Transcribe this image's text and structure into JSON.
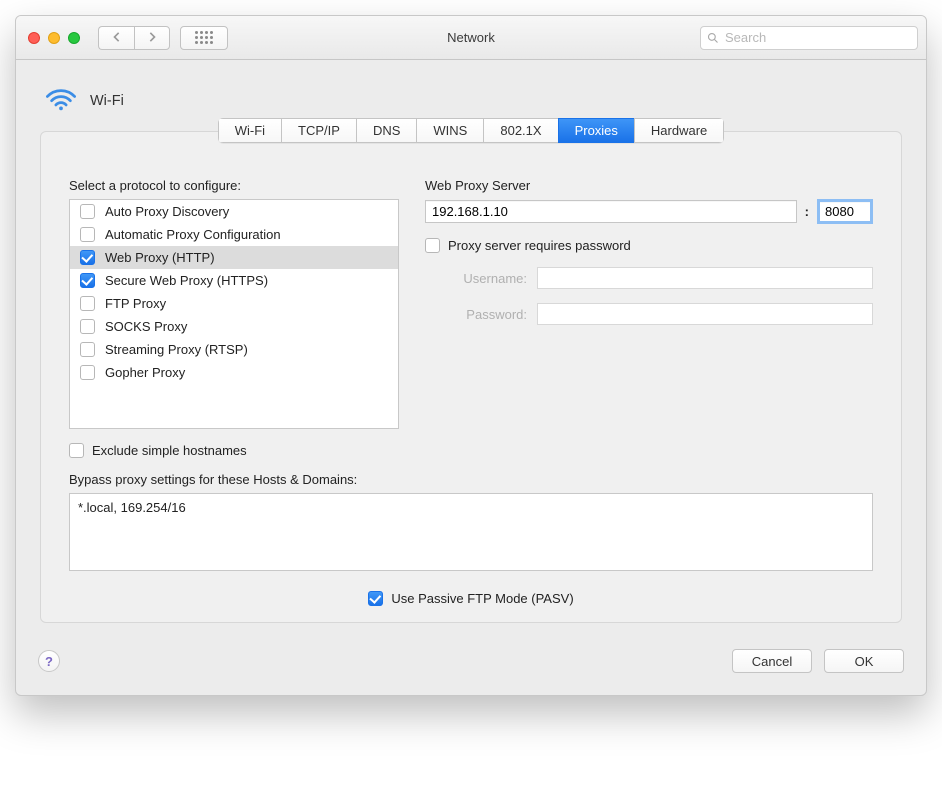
{
  "window": {
    "title": "Network",
    "search_placeholder": "Search"
  },
  "header": {
    "interface_label": "Wi-Fi"
  },
  "tabs": [
    "Wi-Fi",
    "TCP/IP",
    "DNS",
    "WINS",
    "802.1X",
    "Proxies",
    "Hardware"
  ],
  "active_tab_index": 5,
  "left": {
    "section_label": "Select a protocol to configure:",
    "protocols": [
      {
        "label": "Auto Proxy Discovery",
        "checked": false,
        "selected": false
      },
      {
        "label": "Automatic Proxy Configuration",
        "checked": false,
        "selected": false
      },
      {
        "label": "Web Proxy (HTTP)",
        "checked": true,
        "selected": true
      },
      {
        "label": "Secure Web Proxy (HTTPS)",
        "checked": true,
        "selected": false
      },
      {
        "label": "FTP Proxy",
        "checked": false,
        "selected": false
      },
      {
        "label": "SOCKS Proxy",
        "checked": false,
        "selected": false
      },
      {
        "label": "Streaming Proxy (RTSP)",
        "checked": false,
        "selected": false
      },
      {
        "label": "Gopher Proxy",
        "checked": false,
        "selected": false
      }
    ],
    "exclude_label": "Exclude simple hostnames",
    "exclude_checked": false
  },
  "right": {
    "server_label": "Web Proxy Server",
    "host": "192.168.1.10",
    "port": "8080",
    "requires_password_label": "Proxy server requires password",
    "requires_password_checked": false,
    "username_label": "Username:",
    "password_label": "Password:"
  },
  "bypass": {
    "label": "Bypass proxy settings for these Hosts & Domains:",
    "value": "*.local, 169.254/16"
  },
  "pasv": {
    "label": "Use Passive FTP Mode (PASV)",
    "checked": true
  },
  "buttons": {
    "cancel": "Cancel",
    "ok": "OK"
  }
}
